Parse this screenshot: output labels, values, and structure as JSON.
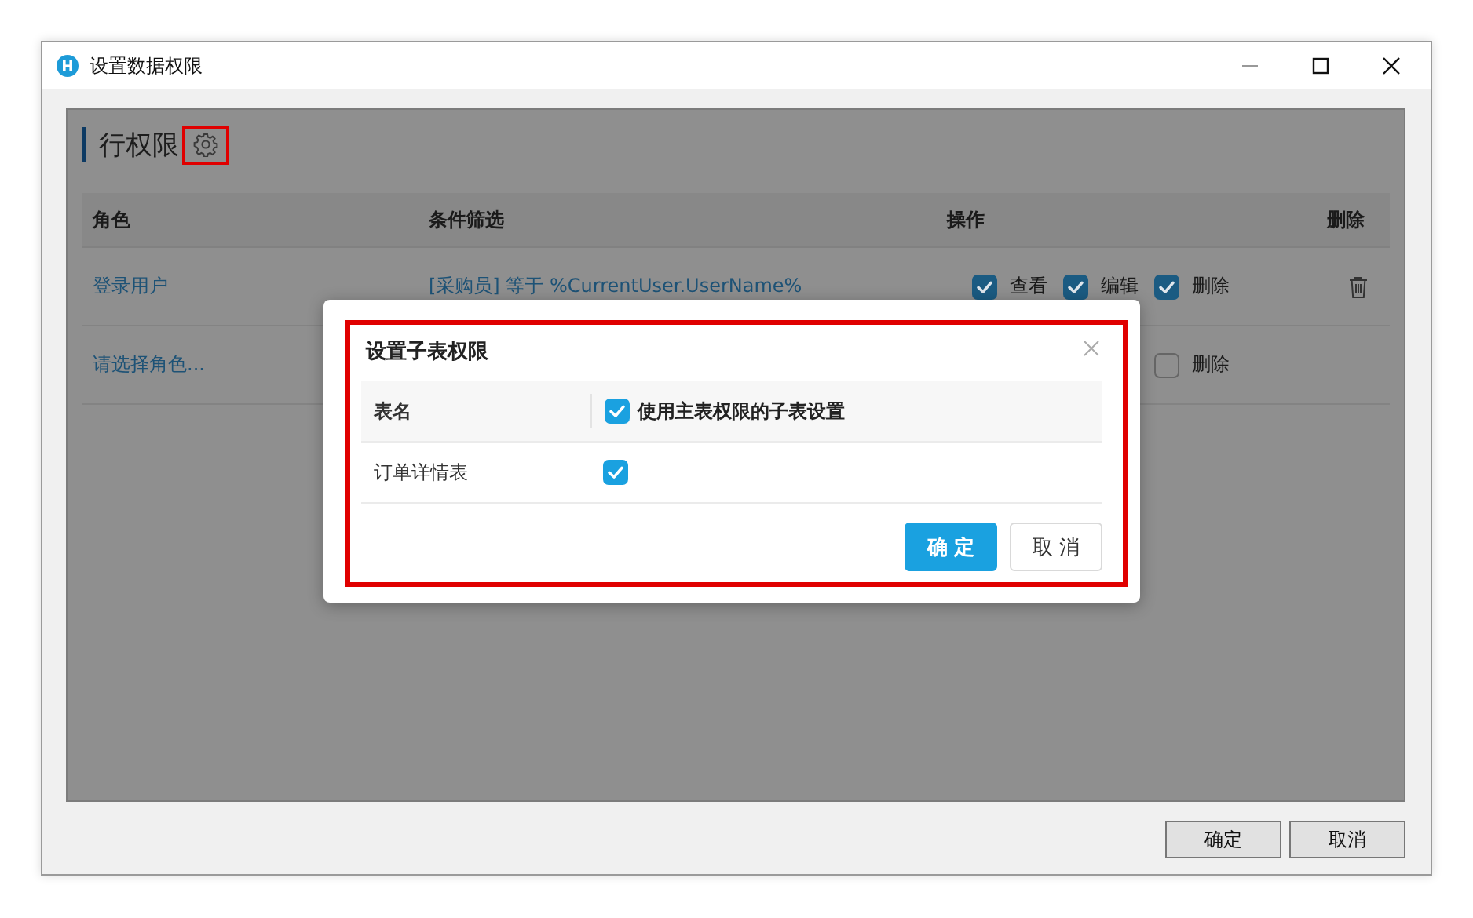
{
  "window": {
    "title": "设置数据权限"
  },
  "section": {
    "title": "行权限"
  },
  "table": {
    "columns": [
      "角色",
      "条件筛选",
      "操作",
      "删除"
    ],
    "rows": [
      {
        "role": "登录用户",
        "condition": "[采购员] 等于 %CurrentUser.UserName%",
        "operations": [
          {
            "label": "查看",
            "checked": true
          },
          {
            "label": "编辑",
            "checked": true
          },
          {
            "label": "删除",
            "checked": true
          }
        ],
        "deletable": true
      },
      {
        "role": "请选择角色...",
        "operations": [
          {
            "label": "删除",
            "checked": false
          }
        ],
        "deletable": false
      }
    ]
  },
  "dialog": {
    "title": "设置子表权限",
    "column": "表名",
    "header_option": {
      "label": "使用主表权限的子表设置",
      "checked": true
    },
    "rows": [
      {
        "name": "订单详情表",
        "checked": true
      }
    ],
    "buttons": [
      {
        "label": "确定",
        "kind": "primary"
      },
      {
        "label": "取消",
        "kind": "default"
      }
    ]
  },
  "buttons": [
    "确定",
    "取消"
  ]
}
